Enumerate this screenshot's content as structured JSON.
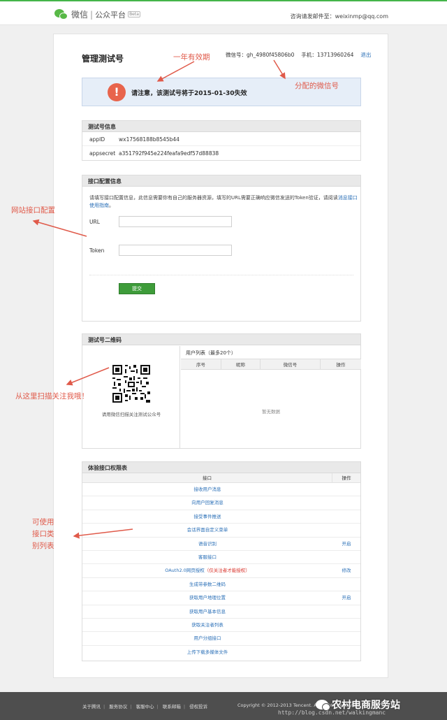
{
  "header": {
    "logo_text": "微信",
    "logo_sep": "|",
    "logo_sub": "公众平台",
    "logo_badge": "Beta",
    "contact": "咨询请发邮件至：weixinmp@qq.com"
  },
  "account": {
    "page_title": "管理测试号",
    "wechat_id_label": "微信号：",
    "wechat_id": "gh_4980f45806b0",
    "phone_label": "手机：",
    "phone": "13713960264",
    "logout": "退出"
  },
  "notice": {
    "icon": "exclamation-icon",
    "text": "请注意，该测试号将于2015-01-30失效"
  },
  "test_info": {
    "title": "测试号信息",
    "rows": [
      {
        "key": "appID",
        "value": "wx17568188b8545b44"
      },
      {
        "key": "appsecret",
        "value": "a351792f945e224feafa9edf57d88838"
      }
    ]
  },
  "config": {
    "title": "接口配置信息",
    "desc": "请填写接口配置信息，此信息需要你有自己的服务器资源，填写的URL需要正确响应微信发送的Token验证，请阅读",
    "desc_link": "消息接口使用指南",
    "desc_end": "。",
    "url_label": "URL",
    "url_value": "",
    "token_label": "Token",
    "token_value": "",
    "submit": "提交"
  },
  "qrcode": {
    "title": "测试号二维码",
    "caption": "请用微信扫描关注测试公众号",
    "user_list_title": "用户列表（最多20个）",
    "columns": [
      "序号",
      "昵称",
      "微信号",
      "操作"
    ],
    "empty": "暂无数据"
  },
  "permissions": {
    "title": "体验接口权限表",
    "columns": [
      "接口",
      "操作"
    ],
    "rows": [
      {
        "name": "接收用户消息",
        "action": ""
      },
      {
        "name": "向用户回复消息",
        "action": ""
      },
      {
        "name": "接受事件推送",
        "action": ""
      },
      {
        "name": "会话界面自定义菜单",
        "action": ""
      },
      {
        "name": "语音识别",
        "action": "开启"
      },
      {
        "name": "客服接口",
        "action": ""
      },
      {
        "name": "OAuth2.0网页授权",
        "note": "（仅关注者才能授权）",
        "action": "修改"
      },
      {
        "name": "生成带参数二维码",
        "action": ""
      },
      {
        "name": "获取用户地理位置",
        "action": "开启"
      },
      {
        "name": "获取用户基本信息",
        "action": ""
      },
      {
        "name": "获取关注者列表",
        "action": ""
      },
      {
        "name": "用户分组接口",
        "action": ""
      },
      {
        "name": "上传下载多媒体文件",
        "action": ""
      }
    ]
  },
  "annotations": {
    "validity": "一年有效期",
    "assigned_id": "分配的微信号",
    "site_config": "网站接口配置",
    "scan": "从这里扫描关注我哦！",
    "perm_1": "可使用",
    "perm_2": "接口类",
    "perm_3": "别列表",
    "color": "#e05a4a"
  },
  "footer": {
    "links": [
      "关于腾讯",
      "服务协议",
      "客服中心",
      "联系邮箱",
      "侵权投诉"
    ],
    "copyright": "Copyright © 2012-2013 Tencent. All Rights Reserved.",
    "watermark": "农村电商服务站",
    "blog": "http://blog.csdn.net/walkingmanc"
  }
}
